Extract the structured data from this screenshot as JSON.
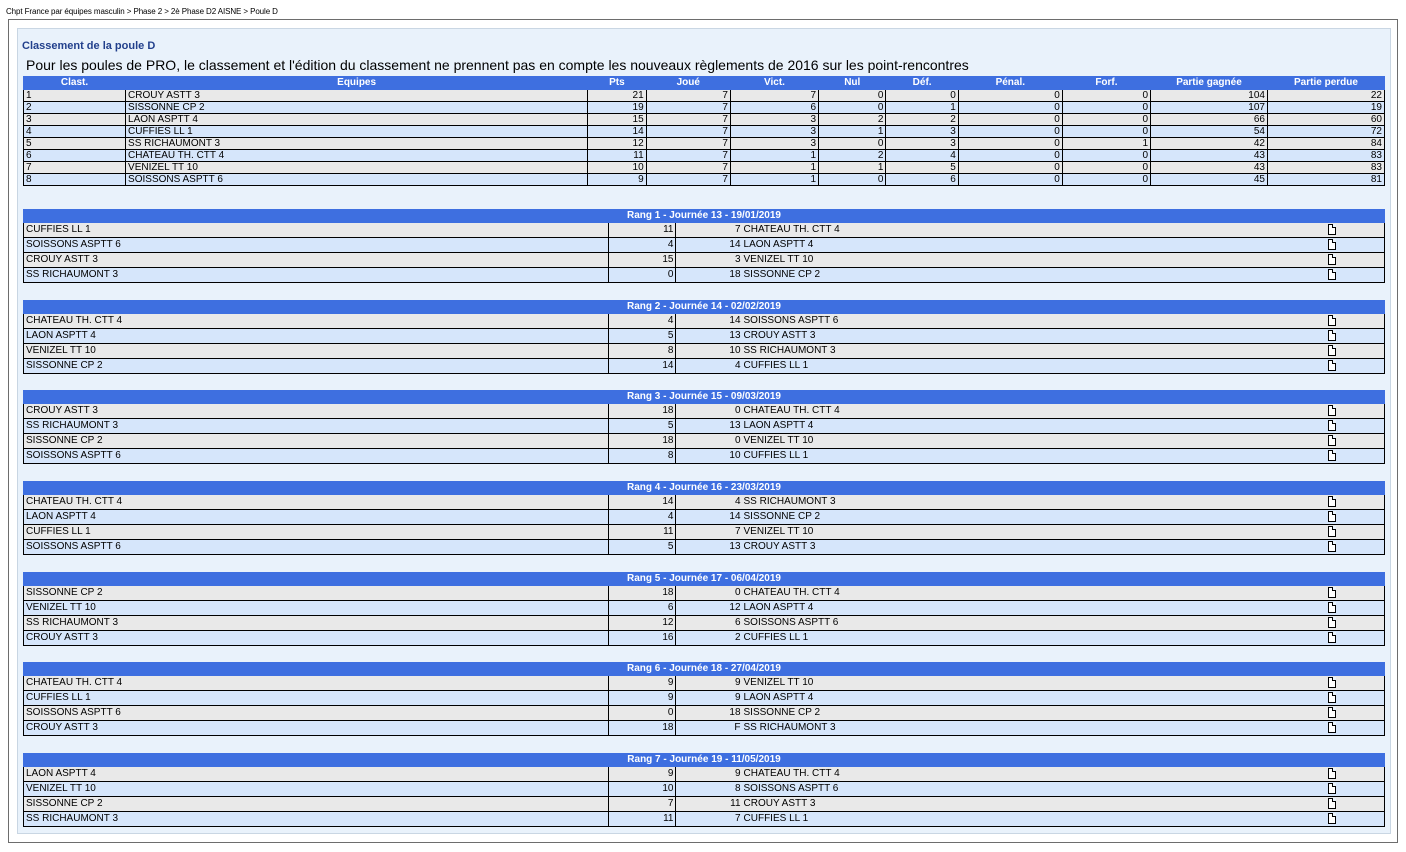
{
  "breadcrumb": "Chpt France par équipes masculin > Phase 2 > 2è Phase D2 AISNE > Poule D",
  "title": "Classement de la poule D",
  "notice": "Pour les poules de PRO, le classement et l'édition du classement ne prennent pas en compte les nouveaux règlements de 2016 sur les point-rencontres",
  "standings": {
    "headers": [
      "Clast.",
      "Equipes",
      "Pts",
      "Joué",
      "Vict.",
      "Nul",
      "Déf.",
      "Pénal.",
      "Forf.",
      "Partie gagnée",
      "Partie perdue"
    ],
    "rows": [
      [
        "1",
        "CROUY ASTT 3",
        "21",
        "7",
        "7",
        "0",
        "0",
        "0",
        "0",
        "104",
        "22"
      ],
      [
        "2",
        "SISSONNE CP 2",
        "19",
        "7",
        "6",
        "0",
        "1",
        "0",
        "0",
        "107",
        "19"
      ],
      [
        "3",
        "LAON ASPTT 4",
        "15",
        "7",
        "3",
        "2",
        "2",
        "0",
        "0",
        "66",
        "60"
      ],
      [
        "4",
        "CUFFIES LL 1",
        "14",
        "7",
        "3",
        "1",
        "3",
        "0",
        "0",
        "54",
        "72"
      ],
      [
        "5",
        "SS RICHAUMONT 3",
        "12",
        "7",
        "3",
        "0",
        "3",
        "0",
        "1",
        "42",
        "84"
      ],
      [
        "6",
        "CHATEAU TH. CTT 4",
        "11",
        "7",
        "1",
        "2",
        "4",
        "0",
        "0",
        "43",
        "83"
      ],
      [
        "7",
        "VENIZEL TT 10",
        "10",
        "7",
        "1",
        "1",
        "5",
        "0",
        "0",
        "43",
        "83"
      ],
      [
        "8",
        "SOISSONS ASPTT 6",
        "9",
        "7",
        "1",
        "0",
        "6",
        "0",
        "0",
        "45",
        "81"
      ]
    ]
  },
  "rounds": [
    {
      "title": "Rang 1 - Journée 13 - 19/01/2019",
      "matches": [
        {
          "home": "CUFFIES LL 1",
          "s1": "11",
          "s2": "7",
          "away": "CHATEAU TH. CTT 4"
        },
        {
          "home": "SOISSONS ASPTT 6",
          "s1": "4",
          "s2": "14",
          "away": "LAON ASPTT 4"
        },
        {
          "home": "CROUY ASTT 3",
          "s1": "15",
          "s2": "3",
          "away": "VENIZEL TT 10"
        },
        {
          "home": "SS RICHAUMONT 3",
          "s1": "0",
          "s2": "18",
          "away": "SISSONNE CP 2"
        }
      ]
    },
    {
      "title": "Rang 2 - Journée 14 - 02/02/2019",
      "matches": [
        {
          "home": "CHATEAU TH. CTT 4",
          "s1": "4",
          "s2": "14",
          "away": "SOISSONS ASPTT 6"
        },
        {
          "home": "LAON ASPTT 4",
          "s1": "5",
          "s2": "13",
          "away": "CROUY ASTT 3"
        },
        {
          "home": "VENIZEL TT 10",
          "s1": "8",
          "s2": "10",
          "away": "SS RICHAUMONT 3"
        },
        {
          "home": "SISSONNE CP 2",
          "s1": "14",
          "s2": "4",
          "away": "CUFFIES LL 1"
        }
      ]
    },
    {
      "title": "Rang 3 - Journée 15 - 09/03/2019",
      "matches": [
        {
          "home": "CROUY ASTT 3",
          "s1": "18",
          "s2": "0",
          "away": "CHATEAU TH. CTT 4"
        },
        {
          "home": "SS RICHAUMONT 3",
          "s1": "5",
          "s2": "13",
          "away": "LAON ASPTT 4"
        },
        {
          "home": "SISSONNE CP 2",
          "s1": "18",
          "s2": "0",
          "away": "VENIZEL TT 10"
        },
        {
          "home": "SOISSONS ASPTT 6",
          "s1": "8",
          "s2": "10",
          "away": "CUFFIES LL 1"
        }
      ]
    },
    {
      "title": "Rang 4 - Journée 16 - 23/03/2019",
      "matches": [
        {
          "home": "CHATEAU TH. CTT 4",
          "s1": "14",
          "s2": "4",
          "away": "SS RICHAUMONT 3"
        },
        {
          "home": "LAON ASPTT 4",
          "s1": "4",
          "s2": "14",
          "away": "SISSONNE CP 2"
        },
        {
          "home": "CUFFIES LL 1",
          "s1": "11",
          "s2": "7",
          "away": "VENIZEL TT 10"
        },
        {
          "home": "SOISSONS ASPTT 6",
          "s1": "5",
          "s2": "13",
          "away": "CROUY ASTT 3"
        }
      ]
    },
    {
      "title": "Rang 5 - Journée 17 - 06/04/2019",
      "matches": [
        {
          "home": "SISSONNE CP 2",
          "s1": "18",
          "s2": "0",
          "away": "CHATEAU TH. CTT 4"
        },
        {
          "home": "VENIZEL TT 10",
          "s1": "6",
          "s2": "12",
          "away": "LAON ASPTT 4"
        },
        {
          "home": "SS RICHAUMONT 3",
          "s1": "12",
          "s2": "6",
          "away": "SOISSONS ASPTT 6"
        },
        {
          "home": "CROUY ASTT 3",
          "s1": "16",
          "s2": "2",
          "away": "CUFFIES LL 1"
        }
      ]
    },
    {
      "title": "Rang 6 - Journée 18 - 27/04/2019",
      "matches": [
        {
          "home": "CHATEAU TH. CTT 4",
          "s1": "9",
          "s2": "9",
          "away": "VENIZEL TT 10"
        },
        {
          "home": "CUFFIES LL 1",
          "s1": "9",
          "s2": "9",
          "away": "LAON ASPTT 4"
        },
        {
          "home": "SOISSONS ASPTT 6",
          "s1": "0",
          "s2": "18",
          "away": "SISSONNE CP 2"
        },
        {
          "home": "CROUY ASTT 3",
          "s1": "18",
          "s2": "F",
          "away": "SS RICHAUMONT 3"
        }
      ]
    },
    {
      "title": "Rang 7 - Journée 19 - 11/05/2019",
      "matches": [
        {
          "home": "LAON ASPTT 4",
          "s1": "9",
          "s2": "9",
          "away": "CHATEAU TH. CTT 4"
        },
        {
          "home": "VENIZEL TT 10",
          "s1": "10",
          "s2": "8",
          "away": "SOISSONS ASPTT 6"
        },
        {
          "home": "SISSONNE CP 2",
          "s1": "7",
          "s2": "11",
          "away": "CROUY ASTT 3"
        },
        {
          "home": "SS RICHAUMONT 3",
          "s1": "11",
          "s2": "7",
          "away": "CUFFIES LL 1"
        }
      ]
    }
  ],
  "icons": {
    "match_sheet": "document-icon"
  },
  "colors": {
    "header_bg": "#3e6fe0",
    "row_odd": "#e9e9e9",
    "row_even": "#d6e6fb",
    "title": "#22408c"
  }
}
